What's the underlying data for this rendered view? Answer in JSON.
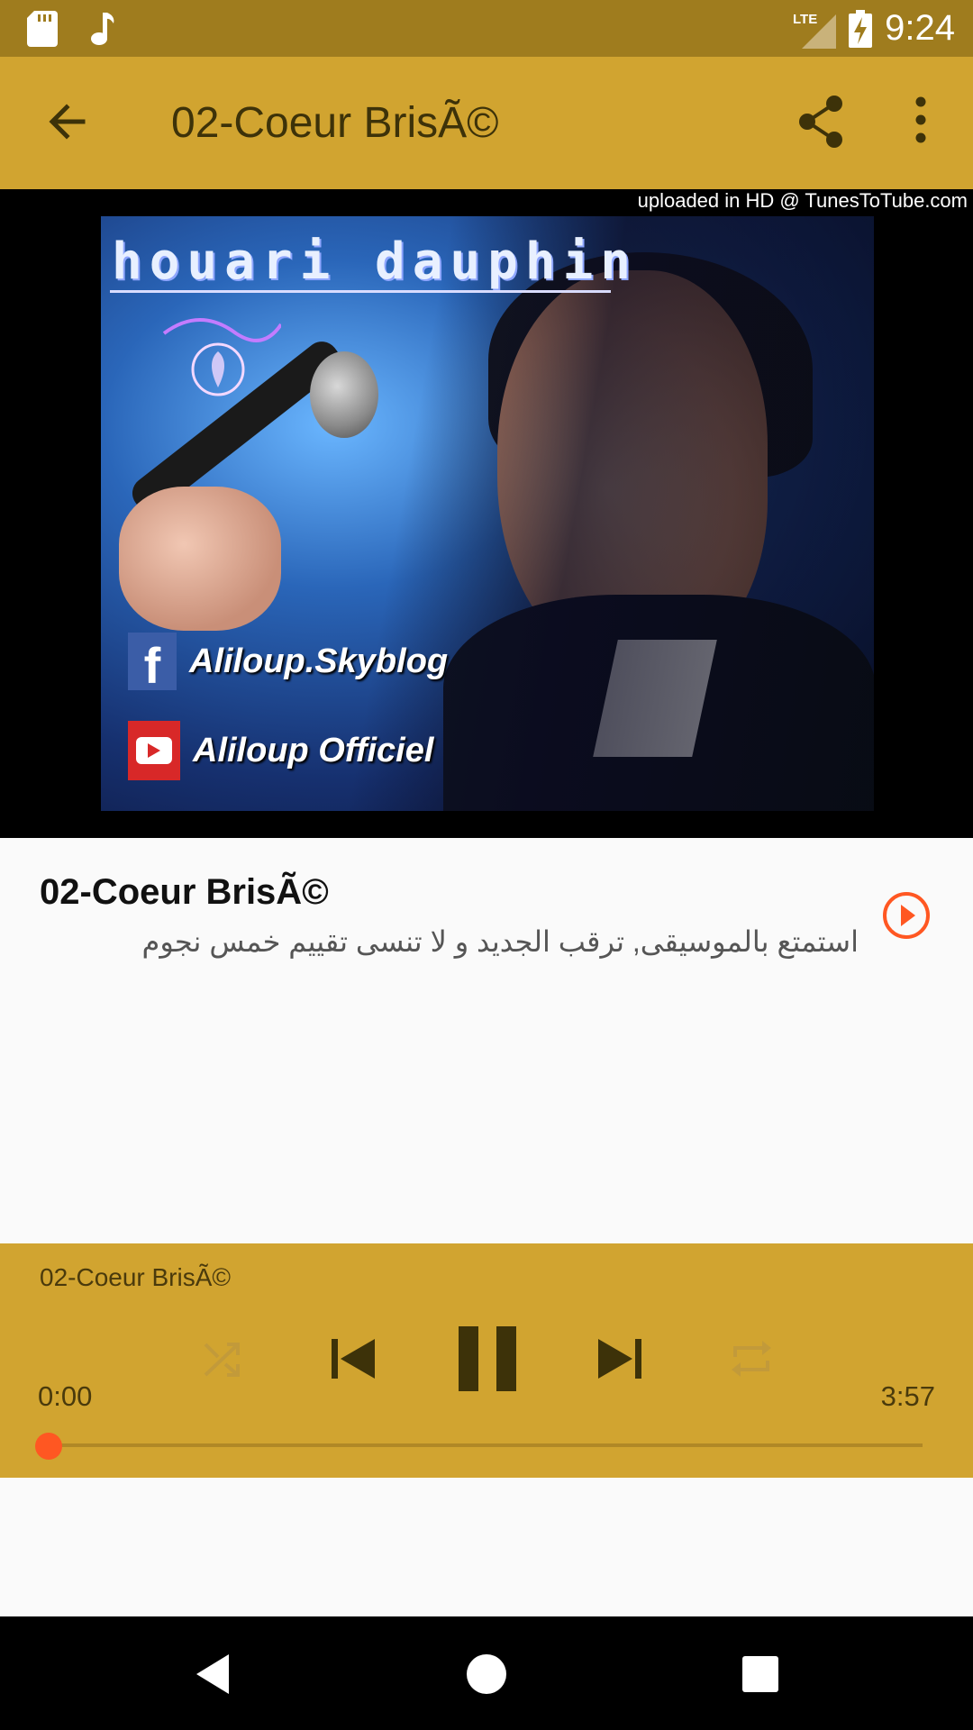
{
  "status_bar": {
    "time": "9:24",
    "network": "LTE",
    "icons": [
      "sd-card-icon",
      "music-note-icon",
      "signal-icon",
      "battery-charging-icon"
    ]
  },
  "app_bar": {
    "title": "02-Coeur BrisÃ©",
    "back_icon": "arrow-back-icon",
    "share_icon": "share-icon",
    "more_icon": "more-vert-icon"
  },
  "video": {
    "watermark": "uploaded in HD @ TunesToTube.com",
    "brand_text": "houari dauphin",
    "facebook_text": "Aliloup.Skyblog",
    "youtube_text": "Aliloup Officiel"
  },
  "song": {
    "title": "02-Coeur BrisÃ©",
    "description": "استمتع بالموسيقى, ترقب الجديد و لا تنسى تقييم خمس نجوم",
    "play_icon": "play-circle-icon"
  },
  "player": {
    "title": "02-Coeur BrisÃ©",
    "elapsed": "0:00",
    "total": "3:57",
    "progress": 0.0,
    "controls": [
      "shuffle-icon",
      "skip-previous-icon",
      "pause-icon",
      "skip-next-icon",
      "repeat-icon"
    ]
  },
  "colors": {
    "status_bar": "#9f7c1e",
    "accent": "#d1a430",
    "seek_thumb": "#ff5722"
  },
  "nav_bar": {
    "icons": [
      "nav-back-icon",
      "nav-home-icon",
      "nav-recents-icon"
    ]
  }
}
